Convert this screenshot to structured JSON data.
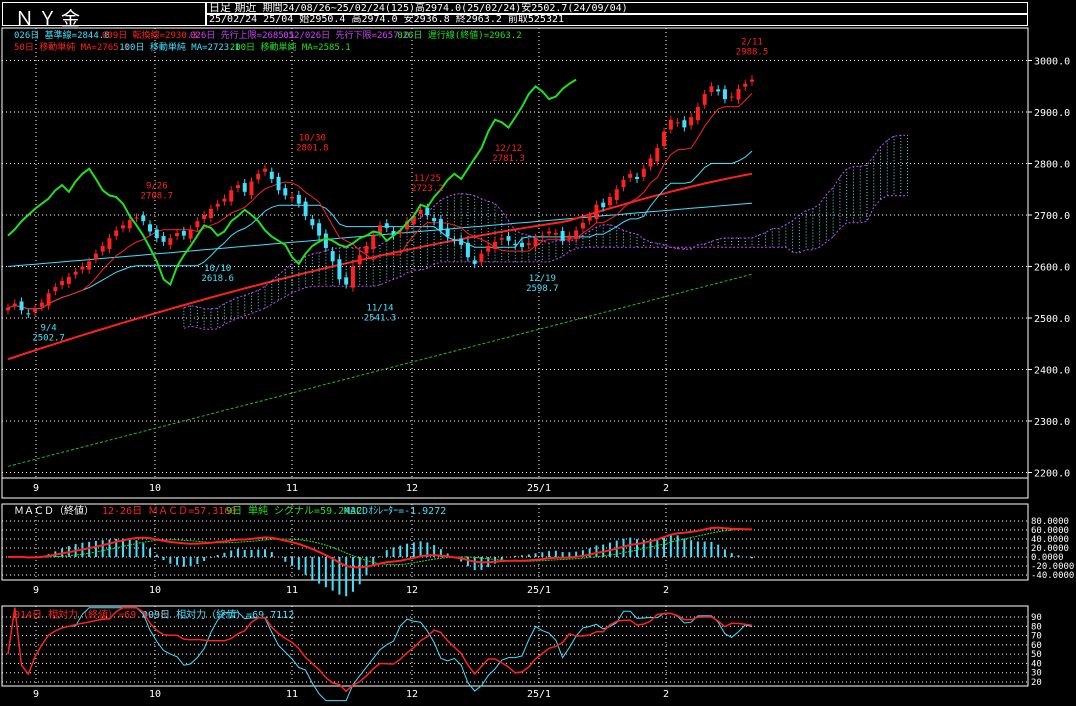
{
  "header": {
    "title": "ＮＹ金",
    "mode_label": "日足 期近",
    "period_info": "期間24/08/26~25/02/24(125)高2974.0(25/02/24)安2502.7(24/09/04)",
    "ohlc_info": "25/02/24 25/04 始2950.4 高2974.0 安2936.8 終2963.2 前取525321"
  },
  "colors": {
    "background": "#000000",
    "grid": "#ffffff",
    "candle_up": "#ff2020",
    "candle_down": "#40e0ff",
    "tenkan": "#ff2020",
    "kijun": "#40e0ff",
    "chikou": "#20e020",
    "senkou_a": "#d040ff",
    "senkou_b": "#d040ff",
    "cloud": "#50e8e8",
    "ma50": "#ff2020",
    "ma100": "#40e0ff",
    "ma200": "#20c020",
    "macd": "#ff2020",
    "macd_signal": "#20e020",
    "macd_hist": "#40e0ff",
    "rsi14": "#ff2020",
    "rsi9": "#40e0ff"
  },
  "chart_data": [
    {
      "type": "candlestick",
      "panel": "price",
      "legend_line1": [
        {
          "text": "026日 基準線=2844.8",
          "color": "#40e0ff"
        },
        {
          "text": "009日 転換線=2930.3",
          "color": "#ff2020"
        },
        {
          "text": "026日 先行上限=2685.1",
          "color": "#d040ff"
        },
        {
          "text": "052/026日 先行下限=2657.0",
          "color": "#d040ff"
        },
        {
          "text": "026日 遅行線(終値)=2963.2",
          "color": "#20e020"
        }
      ],
      "legend_line2": [
        {
          "text": "50日 移動単純 MA=2765.1",
          "color": "#ff2020"
        },
        {
          "text": "100日 移動単純 MA=2723.1",
          "color": "#40e0ff"
        },
        {
          "text": "200日 移動単純 MA=2585.1",
          "color": "#20e020"
        }
      ],
      "x_ticks": [
        "9",
        "10",
        "11",
        "12",
        "25/1",
        "2"
      ],
      "y_ticks": [
        "3000.0",
        "2900.0",
        "2800.0",
        "2700.0",
        "2600.0",
        "2500.0",
        "2400.0",
        "2300.0",
        "2200.0"
      ],
      "ylim": [
        2200,
        3000
      ],
      "annotations": [
        {
          "date": "9/4",
          "value": "2502.7",
          "price": 2502.7,
          "pos": "below",
          "color": "#40e0ff"
        },
        {
          "date": "9/26",
          "value": "2708.7",
          "price": 2708.7,
          "pos": "above",
          "color": "#ff2020"
        },
        {
          "date": "10/10",
          "value": "2618.6",
          "price": 2618.6,
          "pos": "below",
          "color": "#40e0ff"
        },
        {
          "date": "10/30",
          "value": "2801.8",
          "price": 2801.8,
          "pos": "above",
          "color": "#ff2020"
        },
        {
          "date": "11/14",
          "value": "2541.3",
          "price": 2541.3,
          "pos": "below",
          "color": "#40e0ff"
        },
        {
          "date": "11/25",
          "value": "2723.2",
          "price": 2723.2,
          "pos": "above",
          "color": "#ff2020"
        },
        {
          "date": "12/12",
          "value": "2781.3",
          "price": 2781.3,
          "pos": "above",
          "color": "#ff2020"
        },
        {
          "date": "12/19",
          "value": "2598.7",
          "price": 2598.7,
          "pos": "below",
          "color": "#40e0ff"
        },
        {
          "date": "2/11",
          "value": "2988.5",
          "price": 2988.5,
          "pos": "above",
          "color": "#ff2020"
        }
      ],
      "candles_note": "daily closes (approx)",
      "closes": [
        2520,
        2528,
        2515,
        2508,
        2518,
        2530,
        2548,
        2560,
        2572,
        2580,
        2590,
        2600,
        2610,
        2625,
        2640,
        2655,
        2670,
        2680,
        2690,
        2695,
        2688,
        2668,
        2655,
        2648,
        2655,
        2665,
        2660,
        2672,
        2688,
        2700,
        2712,
        2722,
        2732,
        2748,
        2758,
        2745,
        2765,
        2780,
        2790,
        2770,
        2748,
        2738,
        2735,
        2722,
        2698,
        2680,
        2660,
        2636,
        2610,
        2575,
        2565,
        2600,
        2622,
        2640,
        2660,
        2680,
        2675,
        2660,
        2668,
        2688,
        2698,
        2710,
        2700,
        2688,
        2670,
        2658,
        2650,
        2642,
        2618,
        2605,
        2625,
        2640,
        2648,
        2655,
        2650,
        2642,
        2638,
        2645,
        2655,
        2660,
        2668,
        2665,
        2650,
        2660,
        2670,
        2685,
        2698,
        2720,
        2715,
        2735,
        2750,
        2768,
        2780,
        2770,
        2790,
        2810,
        2830,
        2862,
        2885,
        2880,
        2870,
        2890,
        2910,
        2935,
        2950,
        2940,
        2925,
        2930,
        2945,
        2955,
        2963
      ],
      "highs": [],
      "lows": []
    },
    {
      "type": "line",
      "panel": "macd",
      "title": "ＭＡＣＤ（終値）",
      "legend": [
        {
          "text": "12-26日 ＭＡＣＤ=57.3160",
          "color": "#ff2020"
        },
        {
          "text": "9日 単純 シグナル=59.2432",
          "color": "#20e020"
        },
        {
          "text": "MACDｵｼﾚｰﾀｰ=-1.9272",
          "color": "#40e0ff"
        }
      ],
      "y_ticks": [
        "80.0000",
        "60.0000",
        "40.0000",
        "20.0000",
        "0.0000",
        "-20.0000",
        "-40.0000"
      ],
      "ylim": [
        -40,
        80
      ],
      "x_ticks": [
        "9",
        "10",
        "11",
        "12",
        "25/1",
        "2"
      ]
    },
    {
      "type": "line",
      "panel": "rsi",
      "legend": [
        {
          "text": "014日 相対力（終値）=69.1958",
          "color": "#ff2020"
        },
        {
          "text": "009日 相対力（終値）=69.7112",
          "color": "#40e0ff"
        }
      ],
      "y_ticks": [
        "90",
        "80",
        "70",
        "60",
        "50",
        "40",
        "30",
        "20"
      ],
      "ylim": [
        20,
        90
      ],
      "x_ticks": [
        "9",
        "10",
        "11",
        "12",
        "25/1",
        "2"
      ]
    }
  ]
}
